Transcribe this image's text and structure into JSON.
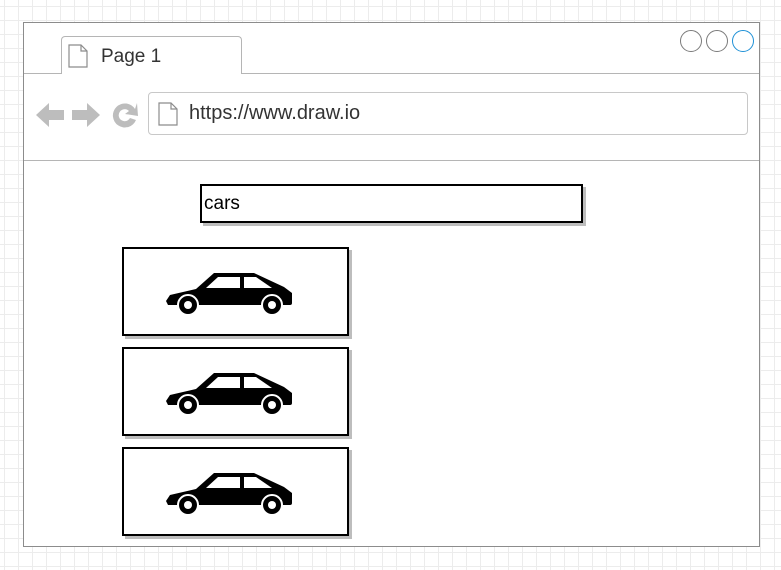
{
  "browser": {
    "tab": {
      "title": "Page 1",
      "icon": "page-icon"
    },
    "window_controls": [
      "minimize-icon",
      "maximize-icon",
      "close-icon"
    ],
    "nav": {
      "back_icon": "arrow-left-icon",
      "forward_icon": "arrow-right-icon",
      "reload_icon": "reload-icon"
    },
    "address": {
      "url": "https://www.draw.io",
      "icon": "page-icon"
    }
  },
  "search": {
    "value": "cars"
  },
  "results": [
    {
      "icon": "car-icon"
    },
    {
      "icon": "car-icon"
    },
    {
      "icon": "car-icon"
    }
  ],
  "colors": {
    "accent": "#1e90d6",
    "nav_icon": "#bdbdbd",
    "border": "#000000",
    "shadow": "#bdbdbd"
  }
}
